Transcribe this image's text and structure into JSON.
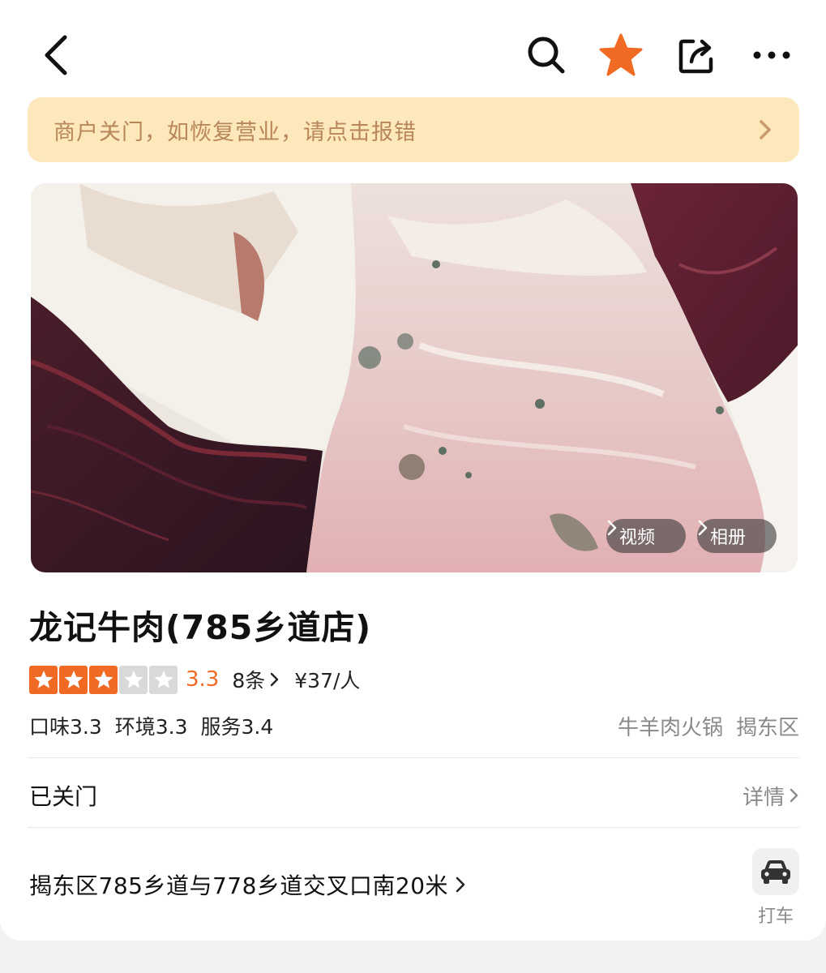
{
  "notice": {
    "text": "商户关门，如恢复营业，请点击报错"
  },
  "photo": {
    "video_label": "视频",
    "album_label": "相册"
  },
  "shop": {
    "name": "龙记牛肉(785乡道店)",
    "rating": {
      "stars": 3,
      "max": 5,
      "score": "3.3"
    },
    "reviews": "8条",
    "price": "¥37/人",
    "subscores": [
      "口味3.3",
      "环境3.3",
      "服务3.4"
    ],
    "tags": [
      "牛羊肉火锅",
      "揭东区"
    ],
    "status": "已关门",
    "detail_label": "详情",
    "address": "揭东区785乡道与778乡道交叉口南20米",
    "taxi_label": "打车"
  },
  "colors": {
    "accent": "#f06a24",
    "notice_bg": "#fde8bc",
    "notice_text": "#b9865a",
    "star_empty": "#d9d9d9"
  },
  "icons": [
    "back-icon",
    "search-icon",
    "favorite-star-icon",
    "share-icon",
    "more-icon",
    "chevron-right-icon",
    "car-icon"
  ]
}
